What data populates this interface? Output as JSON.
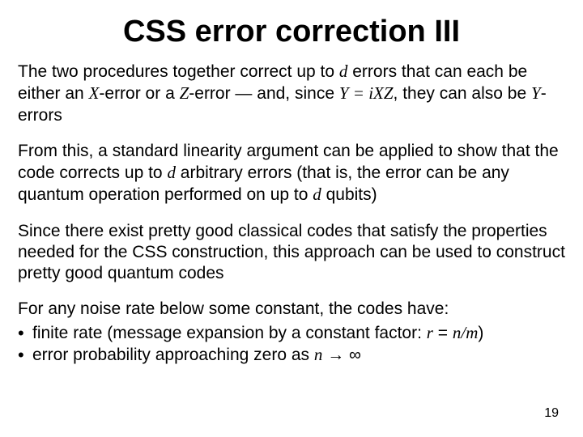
{
  "title": "CSS error correction III",
  "para1": {
    "seg1": "The two procedures together correct up to ",
    "d1": "d",
    "seg2": " errors that can each be either an ",
    "X": "X",
    "seg3": "-error or a ",
    "Z": "Z",
    "seg4": "-error — and, since ",
    "Yeq": "Y = iXZ",
    "seg5": ", they can also be ",
    "Y": "Y",
    "seg6": "-errors"
  },
  "para2": {
    "seg1": "From this, a standard linearity argument can be applied to show that the code corrects up to ",
    "d": "d",
    "seg2": " arbitrary errors (that is, the error can be any quantum operation performed on up to ",
    "d2": "d",
    "seg3": " qubits)"
  },
  "para3": "Since there exist pretty good classical codes that satisfy the properties needed for the CSS construction, this approach can be used to construct pretty good quantum codes",
  "para4_lead": "For any noise rate below some constant, the codes have:",
  "bullets": {
    "b1": {
      "seg1": "finite rate (message expansion by a constant factor: ",
      "r": "r",
      "eq": " = ",
      "nm": "n/m",
      "seg2": ")"
    },
    "b2": {
      "seg1": "error probability approaching zero as ",
      "n": "n",
      "arrow": " → ",
      "inf": "∞"
    }
  },
  "page_number": "19"
}
